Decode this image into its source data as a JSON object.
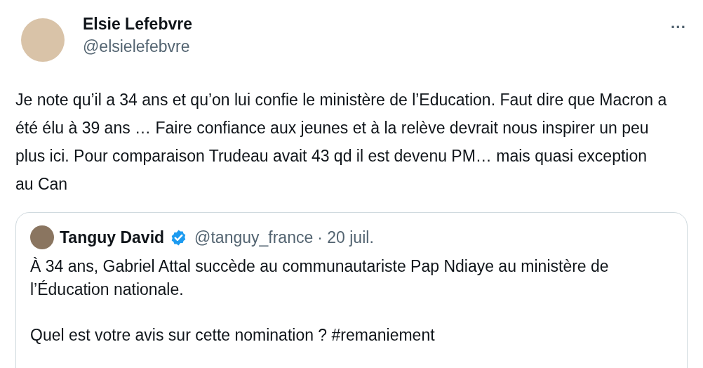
{
  "author": {
    "name": "Elsie Lefebvre",
    "handle": "@elsielefebvre"
  },
  "more_menu": "···",
  "text": "Je note qu’il a 34 ans et qu’on lui confie le ministère de l’Education. Faut dire que Macron a été élu à 39 ans … Faire confiance aux jeunes et à la relève devrait nous inspirer un peu plus ici. Pour comparaison Trudeau avait 43 qd il est devenu PM… mais quasi exception au Can",
  "quoted_tweet": {
    "name": "Tanguy David",
    "verified": true,
    "handle": "@tanguy_france",
    "date": "· 20 juil.",
    "paragraphs": [
      "À 34 ans, Gabriel Attal succède au communautariste Pap Ndiaye au ministère de l’Éducation nationale.",
      "Quel est votre avis sur cette nomination ? #remaniement"
    ]
  }
}
